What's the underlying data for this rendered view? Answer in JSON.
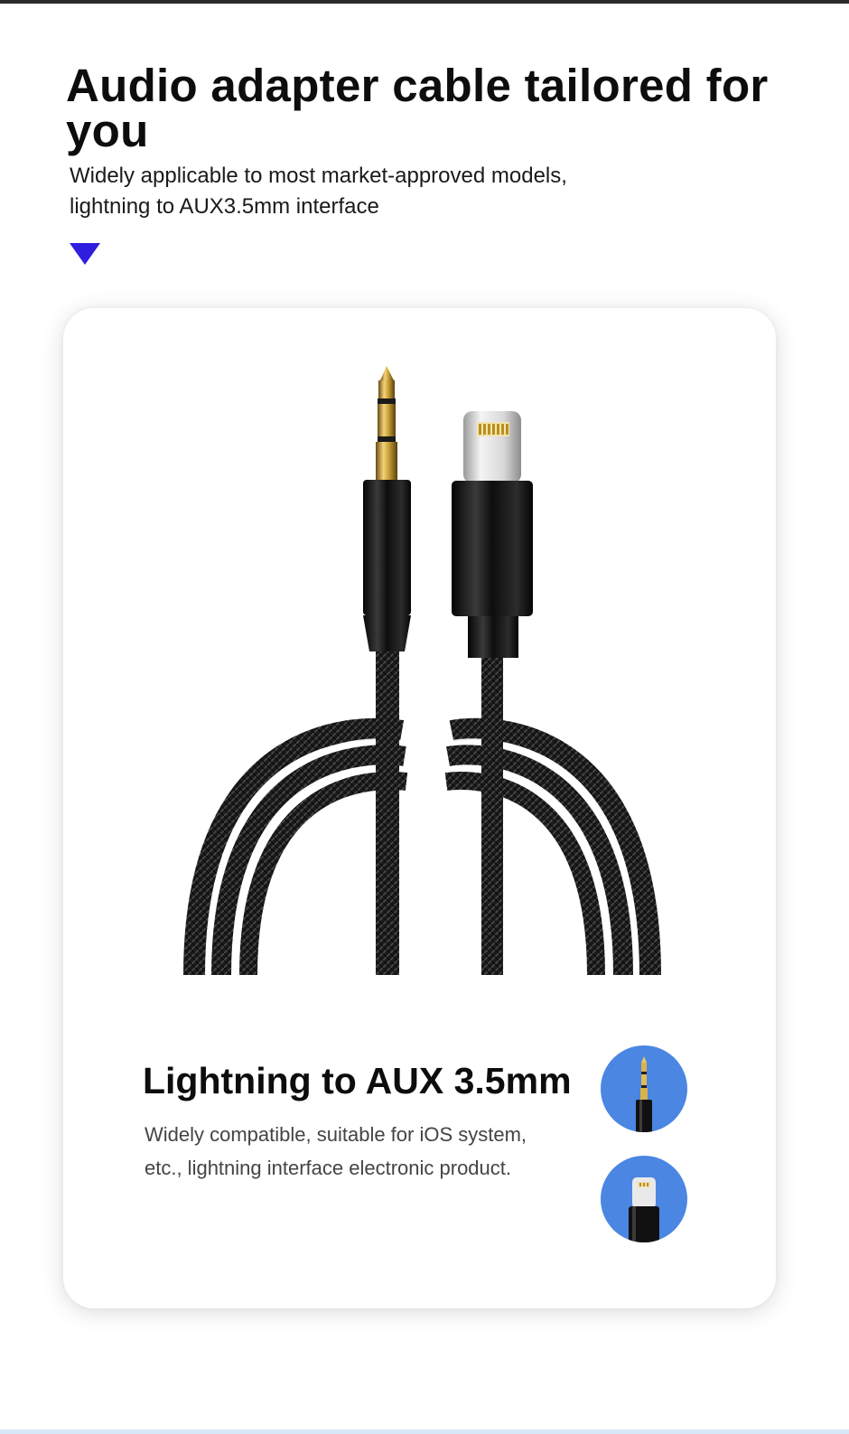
{
  "header": {
    "title": "Audio adapter cable tailored for you",
    "subtitle_line1": "Widely applicable to most market-approved models,",
    "subtitle_line2": "lightning to AUX3.5mm interface"
  },
  "feature": {
    "title": "Lightning to AUX 3.5mm",
    "description_line1": "Widely compatible, suitable for iOS system,",
    "description_line2": "etc., lightning interface electronic product."
  },
  "colors": {
    "accent_marker": "#2f1de0",
    "circle_bg": "#4a86e2",
    "gold": "#c9a238",
    "cable_black": "#141414"
  },
  "icons": [
    "aux-connector-icon",
    "lightning-connector-icon",
    "down-triangle-marker"
  ]
}
